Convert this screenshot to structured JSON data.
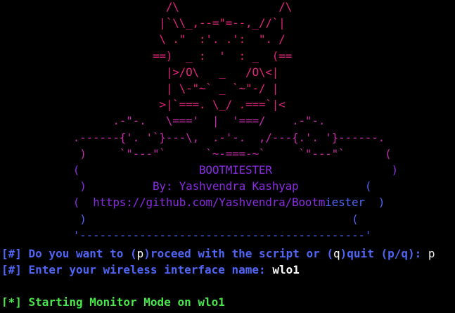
{
  "terminal": {
    "background": "#000000",
    "colors": {
      "magenta": "#e0247a",
      "pink": "#c32ba7",
      "purple": "#8a2be2",
      "blue": "#4f65f4",
      "green": "#49e84a",
      "white": "#ffffff",
      "user": "#e8e8e8"
    },
    "art": [
      [
        {
          "t": "                         /\\               /\\",
          "c": "magenta"
        }
      ],
      [
        {
          "t": "                        |`\\\\_,--=\"=--,_//`|",
          "c": "magenta"
        }
      ],
      [
        {
          "t": "                        \\ .\"  :'. .':  \". /",
          "c": "magenta"
        }
      ],
      [
        {
          "t": "                       ==)  _ :  '  : _  (==",
          "c": "magenta"
        }
      ],
      [
        {
          "t": "                         |>/O\\   _   /O\\<|",
          "c": "magenta"
        }
      ],
      [
        {
          "t": "                         | \\-\"~` _ `~\"-/ |",
          "c": "magenta"
        }
      ],
      [
        {
          "t": "                        >|`===. \\_/ .===`|<",
          "c": "magenta"
        }
      ],
      [
        {
          "t": "                 .-\"-.   \\==='  |  '===/    .-\"-.",
          "c": "pink"
        }
      ],
      [
        {
          "t": "           .------{'. '`}---\\,  .-'-.  ,/---{.'. '}------.",
          "c": "pink"
        }
      ],
      [
        {
          "t": "            )     `\"---\"`      `~-===-~`     `\"---\"`      (",
          "c": "pink"
        }
      ],
      [
        {
          "t": "           (                  ",
          "c": "purple"
        },
        {
          "t": "BOOTMIESTER",
          "c": "purple"
        },
        {
          "t": "                  )",
          "c": "purple"
        }
      ],
      [
        {
          "t": "            )          ",
          "c": "purple"
        },
        {
          "t": "By: Yashvendra Kashyap",
          "c": "purple"
        },
        {
          "t": "          (",
          "c": "blue"
        }
      ],
      [
        {
          "t": "           (  ",
          "c": "purple"
        },
        {
          "t": "https://github.com/Yashvendra/Bootm",
          "c": "purple"
        },
        {
          "t": "iester",
          "c": "blue"
        },
        {
          "t": "  )",
          "c": "blue"
        }
      ],
      [
        {
          "t": "            )                                        (",
          "c": "blue"
        }
      ],
      [
        {
          "t": "           '-------------------------------------------'",
          "c": "blue"
        }
      ]
    ],
    "commands": [
      {
        "segments": [
          {
            "t": "[#] Do you want to (",
            "c": "blue",
            "b": true
          },
          {
            "t": "p",
            "c": "white",
            "b": false
          },
          {
            "t": ")roceed with the script or (",
            "c": "blue",
            "b": true
          },
          {
            "t": "q",
            "c": "white",
            "b": false
          },
          {
            "t": ")quit (",
            "c": "blue",
            "b": true
          },
          {
            "t": "p/q",
            "c": "blue",
            "b": true
          },
          {
            "t": "): ",
            "c": "blue",
            "b": true
          },
          {
            "t": "p",
            "c": "user",
            "b": false
          }
        ]
      },
      {
        "segments": [
          {
            "t": "[#] Enter your wireless interface name: ",
            "c": "blue",
            "b": true
          },
          {
            "t": "wlo1",
            "c": "white",
            "b": true
          }
        ]
      },
      {
        "segments": []
      },
      {
        "segments": [
          {
            "t": "[*] Starting Monitor Mode on wlo1",
            "c": "green",
            "b": true
          }
        ]
      }
    ]
  }
}
